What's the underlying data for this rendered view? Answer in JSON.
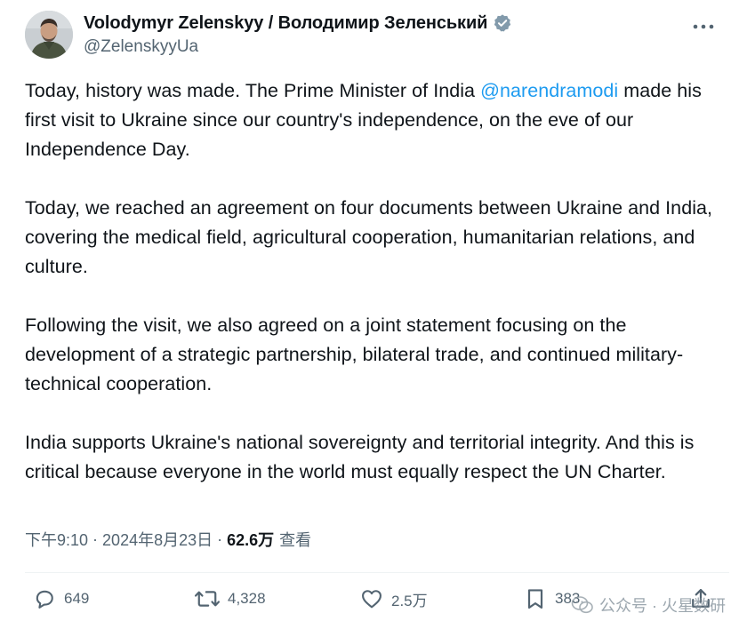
{
  "author": {
    "display_name": "Volodymyr Zelenskyy / Володимир Зеленський",
    "handle": "@ZelenskyyUa",
    "verified": true
  },
  "tweet": {
    "paragraphs": [
      {
        "before": "Today, history was made. The Prime Minister of India ",
        "mention": "@narendramodi",
        "after": " made his first visit to Ukraine since our country's independence, on the eve of our Independence Day."
      },
      {
        "text": "Today, we reached an agreement on four documents between Ukraine and India, covering the medical field, agricultural cooperation, humanitarian relations, and culture."
      },
      {
        "text": "Following the visit, we also agreed on a joint statement focusing on the development of a strategic partnership, bilateral trade, and continued military-technical cooperation."
      },
      {
        "text": "India supports Ukraine's national sovereignty and territorial integrity. And this is critical because everyone in the world must equally respect the UN Charter."
      }
    ]
  },
  "meta": {
    "time": "下午9:10",
    "separator": "·",
    "date": "2024年8月23日",
    "views_count": "62.6万",
    "views_label": "查看"
  },
  "actions": {
    "replies": "649",
    "reposts": "4,328",
    "likes": "2.5万",
    "bookmarks": "383"
  },
  "watermark": {
    "text": "公众号 · 火星数研"
  },
  "icons": {
    "more": "more-dots-icon",
    "verified": "verified-badge-icon",
    "reply": "reply-bubble-icon",
    "repost": "repost-arrows-icon",
    "like": "heart-icon",
    "bookmark": "bookmark-icon",
    "share": "share-upload-icon"
  },
  "colors": {
    "text": "#0f1419",
    "secondary": "#536471",
    "link": "#1d9bf0",
    "divider": "#eff3f4"
  }
}
